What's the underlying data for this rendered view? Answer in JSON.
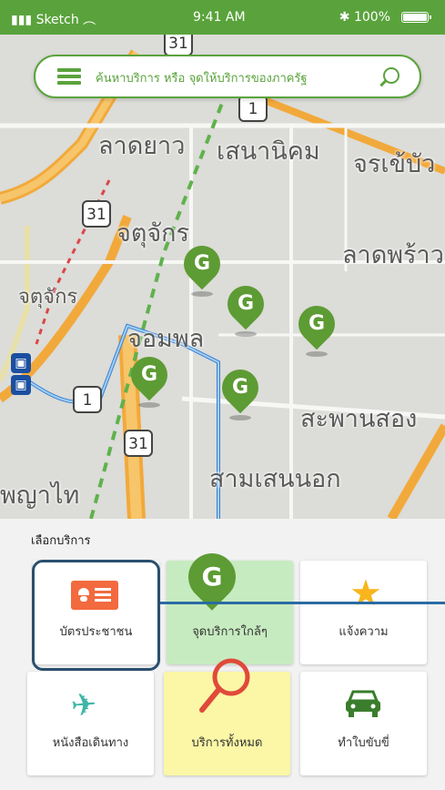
{
  "status_bar": {
    "carrier": "Sketch",
    "time": "9:41 AM",
    "battery": "100%"
  },
  "search": {
    "placeholder": "ค้นหาบริการ หรือ จุดให้บริการของภาครัฐ",
    "menu_icon": "hamburger-menu-icon",
    "search_icon": "magnifier-icon"
  },
  "map": {
    "labels": [
      "ลาดยาว",
      "เสนานิคม",
      "จรเข้บัว",
      "จตุจักร",
      "ลาดพร้าว",
      "จตุจักร",
      "จอมพล",
      "สะพานสอง",
      "สามเสนนอก",
      "พญาไท"
    ],
    "road_shields": [
      "31",
      "1",
      "31",
      "1"
    ],
    "pin_glyph": "G"
  },
  "services": {
    "title": "เลือกบริการ",
    "items": [
      {
        "label": "บัตรประชาชน",
        "icon": "id-card-icon",
        "color": "#f26a3e"
      },
      {
        "label": "จุดบริการใกล้ๆ",
        "icon": "location-pin-icon",
        "color": "#5d9b34"
      },
      {
        "label": "แจ้งความ",
        "icon": "star-icon",
        "color": "#f8b51c"
      },
      {
        "label": "หนังสือเดินทาง",
        "icon": "airplane-icon",
        "color": "#3fb6a8"
      },
      {
        "label": "บริการทั้งหมด",
        "icon": "magnifier-icon",
        "color": "#e04a3a"
      },
      {
        "label": "ทำใบขับขี่",
        "icon": "car-icon",
        "color": "#3a7d2c"
      }
    ]
  },
  "colors": {
    "brand_green": "#5aa33c",
    "highlight_border": "#2a4f6f"
  }
}
